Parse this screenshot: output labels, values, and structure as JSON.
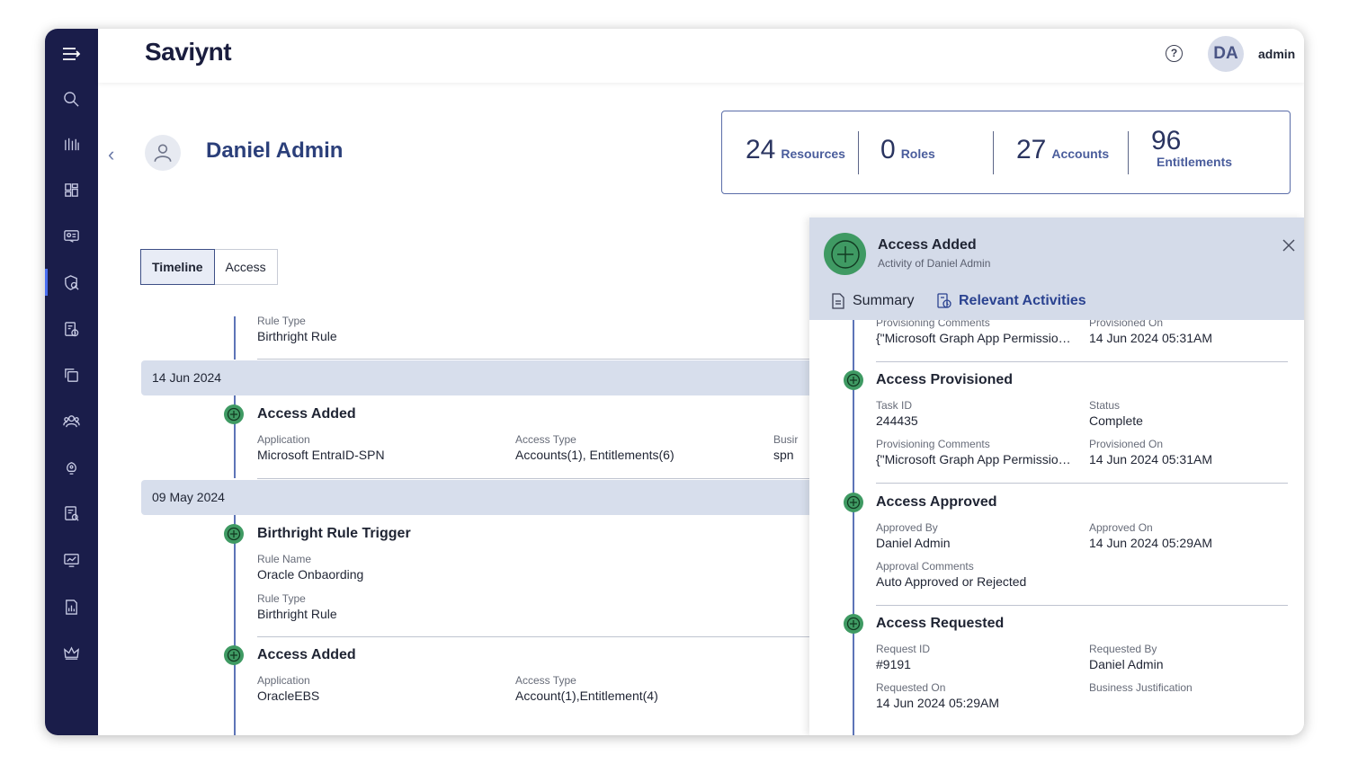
{
  "app": {
    "logo_text": "Saviynt",
    "user_initials": "DA",
    "username": "admin"
  },
  "profile": {
    "name": "Daniel Admin"
  },
  "stats": [
    {
      "value": "24",
      "label": "Resources"
    },
    {
      "value": "0",
      "label": "Roles"
    },
    {
      "value": "27",
      "label": "Accounts"
    },
    {
      "value": "96",
      "label": "Entitlements"
    }
  ],
  "tabs": {
    "timeline": "Timeline",
    "access": "Access"
  },
  "timeline": {
    "top_partial": {
      "label": "Rule Type",
      "value": "Birthright Rule"
    },
    "groups": [
      {
        "date": "14 Jun 2024",
        "events": [
          {
            "title": "Access Added",
            "fields": [
              {
                "label": "Application",
                "value": "Microsoft EntraID-SPN"
              },
              {
                "label": "Access Type",
                "value": "Accounts(1), Entitlements(6)"
              },
              {
                "label": "Busir",
                "value": "spn"
              }
            ]
          }
        ]
      },
      {
        "date": "09 May 2024",
        "events": [
          {
            "title": "Birthright Rule Trigger",
            "fields": [
              {
                "label": "Rule Name",
                "value": "Oracle Onbaording"
              },
              {
                "label": "Rule Type",
                "value": "Birthright Rule"
              }
            ]
          },
          {
            "title": "Access Added",
            "fields": [
              {
                "label": "Application",
                "value": "OracleEBS"
              },
              {
                "label": "Access Type",
                "value": "Account(1),Entitlement(4)"
              }
            ]
          }
        ]
      }
    ]
  },
  "panel": {
    "title": "Access Added",
    "subtitle": "Activity of Daniel Admin",
    "tabs": {
      "summary": "Summary",
      "relevant": "Relevant Activities"
    },
    "top_partial": [
      {
        "label": "Provisioning Comments",
        "value": "{\"Microsoft Graph App Permissio…"
      },
      {
        "label": "Provisioned On",
        "value": "14 Jun 2024 05:31AM"
      }
    ],
    "activities": [
      {
        "title": "Access Provisioned",
        "fields": [
          {
            "label": "Task ID",
            "value": "244435"
          },
          {
            "label": "Status",
            "value": "Complete"
          },
          {
            "label": "Provisioning Comments",
            "value": "{\"Microsoft Graph App Permissio…"
          },
          {
            "label": "Provisioned On",
            "value": "14 Jun 2024 05:31AM"
          }
        ]
      },
      {
        "title": "Access Approved",
        "fields": [
          {
            "label": "Approved By",
            "value": "Daniel Admin"
          },
          {
            "label": "Approved On",
            "value": "14 Jun 2024 05:29AM"
          },
          {
            "label": "Approval Comments",
            "value": "Auto Approved or Rejected"
          }
        ]
      },
      {
        "title": "Access Requested",
        "fields": [
          {
            "label": "Request ID",
            "value": "#9191"
          },
          {
            "label": "Requested By",
            "value": "Daniel Admin"
          },
          {
            "label": "Requested On",
            "value": "14 Jun 2024 05:29AM"
          },
          {
            "label": "Business Justification",
            "value": ""
          }
        ]
      }
    ]
  },
  "colors": {
    "sidebar": "#1a1d4a",
    "accent": "#2a4290",
    "event_icon": "#3f9a63",
    "date_band": "#d7deec",
    "panel_header": "#d4dbe9"
  },
  "icons": {
    "sidebar": [
      "menu-icon",
      "search-icon",
      "analytics-icon",
      "dashboard-icon",
      "id-card-icon",
      "shield-user-icon",
      "request-icon",
      "copy-icon",
      "users-icon",
      "lightbulb-icon",
      "report-icon",
      "monitor-chart-icon",
      "file-chart-icon",
      "crown-icon"
    ]
  }
}
